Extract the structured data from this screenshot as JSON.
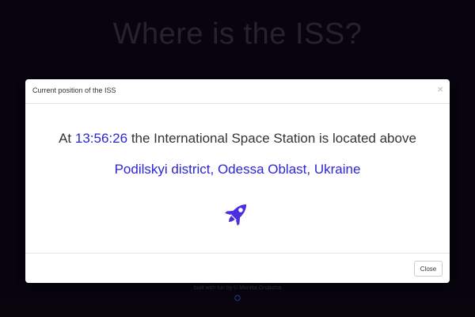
{
  "page": {
    "title": "Where is the ISS?",
    "footer_credit": "built with fun by © Monika Grubizna"
  },
  "modal": {
    "title": "Current position of the ISS",
    "close_symbol": "×",
    "sentence_prefix": "At",
    "time": "13:56:26",
    "sentence_suffix": "the International Space Station is located above",
    "location": "Podilskyi district, Odessa Oblast, Ukraine",
    "icon": "rocket-icon",
    "close_button_label": "Close"
  },
  "colors": {
    "accent": "#2d24d8",
    "background": "#0c0714",
    "text": "#333333"
  }
}
